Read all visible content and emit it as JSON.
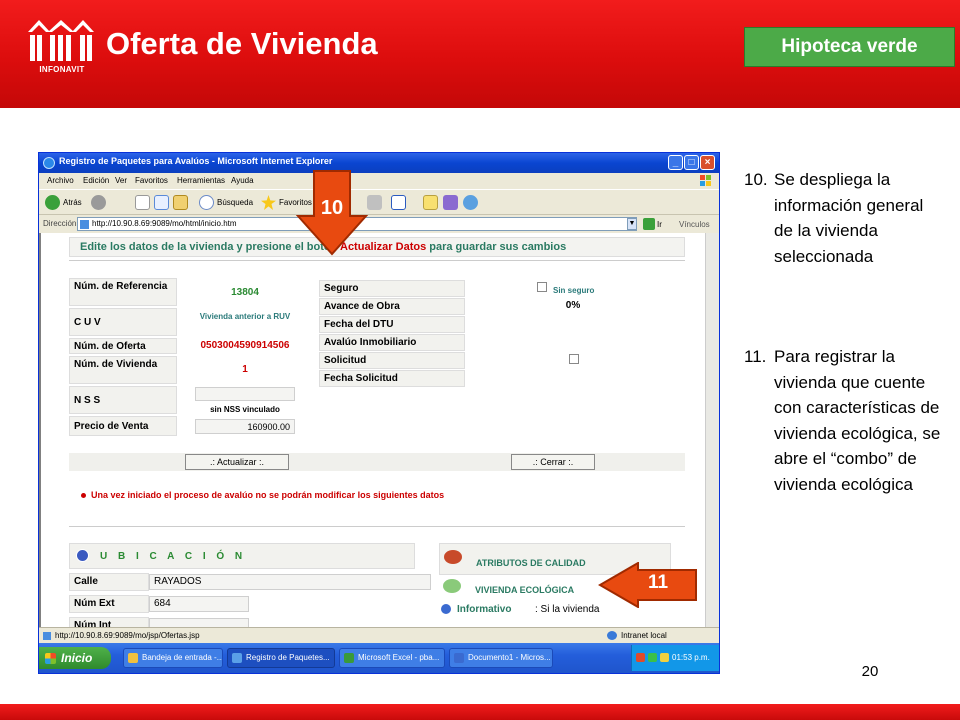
{
  "slide": {
    "title": "Oferta de Vivienda",
    "logo_text": "INFONAVIT",
    "tag": "Hipoteca verde",
    "page_number": "20",
    "colors": {
      "header_red": "#dc0d0d",
      "tag_green": "#4caa48"
    }
  },
  "steps": [
    {
      "number": "10.",
      "text": "Se despliega la información general de la vivienda seleccionada"
    },
    {
      "number": "11.",
      "text": "Para registrar la vivienda que cuente con características de vivienda ecológica, se abre el “combo” de vivienda ecológica"
    }
  ],
  "callouts": {
    "arrow_10": "10",
    "arrow_11": "11"
  },
  "browser": {
    "window_title": "Registro de Paquetes para Avalúos - Microsoft Internet Explorer",
    "menu": [
      "Archivo",
      "Edición",
      "Ver",
      "Favoritos",
      "Herramientas",
      "Ayuda"
    ],
    "toolbar": {
      "back": "Atrás",
      "search": "Búsqueda",
      "favorites": "Favoritos"
    },
    "address_label": "Dirección",
    "address": "http://10.90.8.69:9089/mo/html/inicio.htm",
    "go": "Ir",
    "links": "Vínculos",
    "status_url": "http://10.90.8.69:9089/mo/jsp/Ofertas.jsp",
    "zone": "Intranet local"
  },
  "form": {
    "heading_part1": "Edite los datos de la vivienda y presione el botón ",
    "heading_highlight": "Actualizar Datos",
    "heading_part2": " para guardar sus cambios",
    "fields": {
      "ref_label": "Núm. de Referencia",
      "ref_value": "13804",
      "cuv_label": "C U V",
      "cuv_value": "Vivienda anterior a RUV",
      "oferta_label": "Núm. de Oferta",
      "oferta_value": "0503004590914506",
      "vivienda_label": "Núm. de Vivienda",
      "vivienda_value": "1",
      "nss_label": "N S S",
      "nss_note": "sin NSS vinculado",
      "precio_label": "Precio de Venta",
      "precio_value": "160900.00",
      "seguro_label": "Seguro",
      "seguro_value": "Sin seguro",
      "avance_label": "Avance de Obra",
      "avance_value": "0%",
      "dtu_label": "Fecha del DTU",
      "avaluo_label": "Avalúo Inmobiliario",
      "solicitud_label": "Solicitud",
      "fecha_sol_label": "Fecha Solicitud"
    },
    "btn_update": ".: Actualizar :.",
    "btn_close": ".: Cerrar :.",
    "warning": "Una vez iniciado el proceso de avalúo no se podrán modificar los siguientes datos",
    "ubicacion_title": "U B I C A C I Ó N",
    "calle_label": "Calle",
    "calle_value": "RAYADOS",
    "numext_label": "Núm Ext",
    "numext_value": "684",
    "numint_label": "Núm Int",
    "atributos_title": "ATRIBUTOS DE CALIDAD",
    "ecologica_title": "VIVIENDA ECOLÓGICA",
    "informativo_label": "Informativo",
    "informativo_text": ": Si la vivienda"
  },
  "taskbar": {
    "start": "Inicio",
    "tasks": [
      "Bandeja de entrada -...",
      "Registro de Paquetes...",
      "Microsoft Excel - pba...",
      "Documento1 - Micros..."
    ],
    "clock": "01:53 p.m."
  }
}
